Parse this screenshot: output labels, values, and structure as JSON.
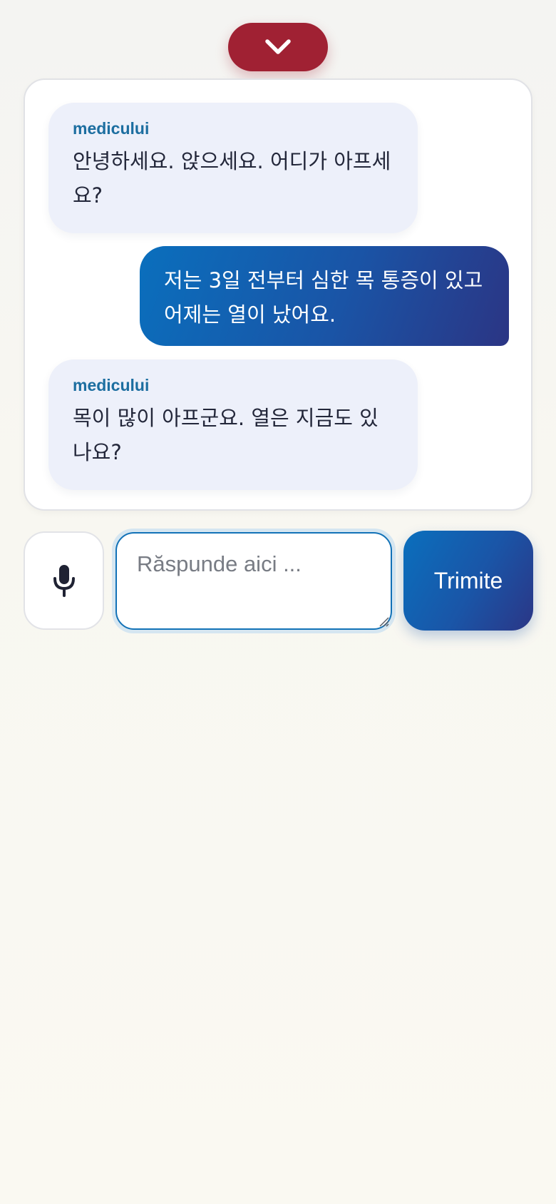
{
  "colors": {
    "collapse_button": "#a02133",
    "doctor_bubble": "#edf0fa",
    "doctor_sender": "#1c6ea0",
    "patient_bubble_start": "#0a6fbd",
    "patient_bubble_end": "#2b3584",
    "input_border": "#1272b7",
    "page_background": "#f8f7f1"
  },
  "collapse_button": {
    "icon": "chevron-down-icon"
  },
  "chat": {
    "messages": [
      {
        "role": "doctor",
        "sender": "medicului",
        "text": "안녕하세요. 앉으세요. 어디가 아프세요?"
      },
      {
        "role": "patient",
        "text": "저는 3일 전부터 심한 목 통증이 있고 어제는 열이 났어요."
      },
      {
        "role": "doctor",
        "sender": "medicului",
        "text": "목이 많이 아프군요. 열은 지금도 있나요?"
      }
    ]
  },
  "composer": {
    "mic_icon": "microphone-icon",
    "input_value": "",
    "input_placeholder": "Răspunde aici ...",
    "send_label": "Trimite"
  }
}
